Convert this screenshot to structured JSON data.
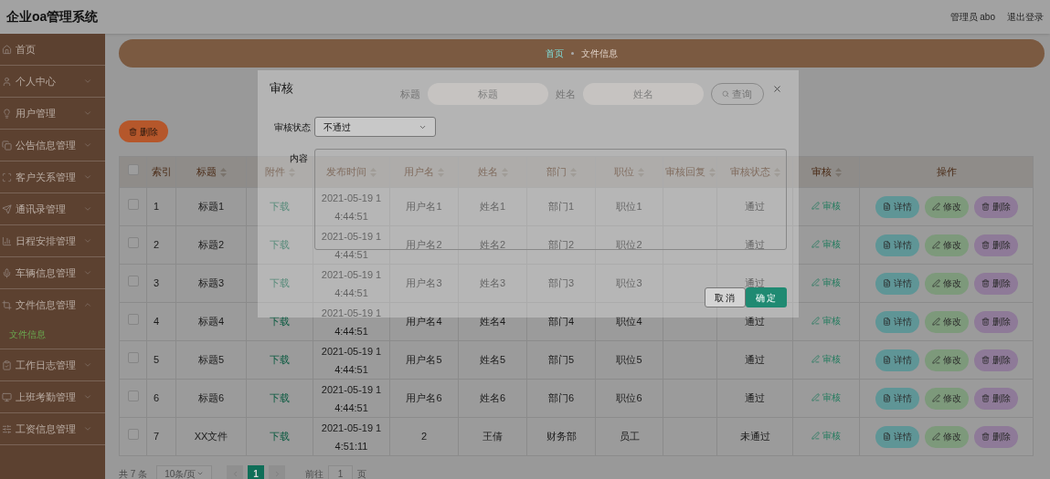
{
  "header": {
    "title": "企业oa管理系统",
    "user": "管理员 abo",
    "logout": "退出登录"
  },
  "sidebar": {
    "items": [
      {
        "label": "首页",
        "kind": "link"
      },
      {
        "label": "个人中心",
        "kind": "submenu",
        "expanded": false
      },
      {
        "label": "用户管理",
        "kind": "submenu",
        "expanded": false
      },
      {
        "label": "公告信息管理",
        "kind": "submenu",
        "expanded": false
      },
      {
        "label": "客户关系管理",
        "kind": "submenu",
        "expanded": false
      },
      {
        "label": "通讯录管理",
        "kind": "submenu",
        "expanded": false
      },
      {
        "label": "日程安排管理",
        "kind": "submenu",
        "expanded": false
      },
      {
        "label": "车辆信息管理",
        "kind": "submenu",
        "expanded": false
      },
      {
        "label": "文件信息管理",
        "kind": "submenu",
        "expanded": true,
        "children": [
          {
            "label": "文件信息",
            "selected": true
          }
        ]
      },
      {
        "label": "工作日志管理",
        "kind": "submenu",
        "expanded": false
      },
      {
        "label": "上班考勤管理",
        "kind": "submenu",
        "expanded": false
      },
      {
        "label": "工资信息管理",
        "kind": "submenu",
        "expanded": false
      }
    ]
  },
  "breadcrumb": [
    "首页",
    "文件信息"
  ],
  "search": {
    "fields": [
      {
        "label": "标题",
        "placeholder": "标题"
      },
      {
        "label": "姓名",
        "placeholder": "姓名"
      }
    ],
    "button": "查询"
  },
  "toolbar": {
    "delete_button": "删除"
  },
  "table": {
    "header_checked": false,
    "columns": [
      {
        "label": "索引",
        "sortable": false
      },
      {
        "label": "标题",
        "sortable": true
      },
      {
        "label": "附件",
        "sortable": true
      },
      {
        "label": "发布时间",
        "sortable": true
      },
      {
        "label": "用户名",
        "sortable": true
      },
      {
        "label": "姓名",
        "sortable": true
      },
      {
        "label": "部门",
        "sortable": true
      },
      {
        "label": "职位",
        "sortable": true
      },
      {
        "label": "审核回复",
        "sortable": true
      },
      {
        "label": "审核状态",
        "sortable": true
      },
      {
        "label": "审核",
        "sortable": true
      },
      {
        "label": "操作",
        "sortable": false
      }
    ],
    "rows": [
      {
        "checked": false,
        "index": "1",
        "title": "标题1",
        "attachment": "下载",
        "published": "2021-05-19 14:44:51",
        "username": "用户名1",
        "name": "姓名1",
        "department": "部门1",
        "position": "职位1",
        "status": "通过",
        "audit": "审核",
        "actions": [
          "详情",
          "修改",
          "删除"
        ]
      },
      {
        "checked": false,
        "index": "2",
        "title": "标题2",
        "attachment": "下载",
        "published": "2021-05-19 14:44:51",
        "username": "用户名2",
        "name": "姓名2",
        "department": "部门2",
        "position": "职位2",
        "status": "通过",
        "audit": "审核",
        "actions": [
          "详情",
          "修改",
          "删除"
        ]
      },
      {
        "checked": false,
        "index": "3",
        "title": "标题3",
        "attachment": "下载",
        "published": "2021-05-19 14:44:51",
        "username": "用户名3",
        "name": "姓名3",
        "department": "部门3",
        "position": "职位3",
        "status": "通过",
        "audit": "审核",
        "actions": [
          "详情",
          "修改",
          "删除"
        ]
      },
      {
        "checked": false,
        "index": "4",
        "title": "标题4",
        "attachment": "下载",
        "published": "2021-05-19 14:44:51",
        "username": "用户名4",
        "name": "姓名4",
        "department": "部门4",
        "position": "职位4",
        "status": "通过",
        "audit": "审核",
        "actions": [
          "详情",
          "修改",
          "删除"
        ]
      },
      {
        "checked": false,
        "index": "5",
        "title": "标题5",
        "attachment": "下载",
        "published": "2021-05-19 14:44:51",
        "username": "用户名5",
        "name": "姓名5",
        "department": "部门5",
        "position": "职位5",
        "status": "通过",
        "audit": "审核",
        "actions": [
          "详情",
          "修改",
          "删除"
        ]
      },
      {
        "checked": false,
        "index": "6",
        "title": "标题6",
        "attachment": "下载",
        "published": "2021-05-19 14:44:51",
        "username": "用户名6",
        "name": "姓名6",
        "department": "部门6",
        "position": "职位6",
        "status": "通过",
        "audit": "审核",
        "actions": [
          "详情",
          "修改",
          "删除"
        ]
      },
      {
        "checked": false,
        "index": "7",
        "title": "XX文件",
        "attachment": "下载",
        "published": "2021-05-19 14:51:11",
        "username": "2",
        "name": "王倩",
        "department": "财务部",
        "position": "员工",
        "status": "未通过",
        "audit": "审核",
        "actions": [
          "详情",
          "修改",
          "删除"
        ]
      }
    ]
  },
  "pagination": {
    "total": "共 7 条",
    "page_size": "10条/页",
    "pages": [
      {
        "label": "1",
        "selected": true
      }
    ],
    "goto_label": "前往",
    "goto_value": "1",
    "goto_suffix": "页"
  },
  "dialog": {
    "title": "审核",
    "fields": [
      {
        "kind": "select",
        "label": "审核状态",
        "value": "不通过"
      },
      {
        "kind": "textarea",
        "label": "内容"
      }
    ],
    "buttons": [
      {
        "label": "取消",
        "kind": "secondary"
      },
      {
        "label": "确定",
        "kind": "primary"
      }
    ]
  }
}
